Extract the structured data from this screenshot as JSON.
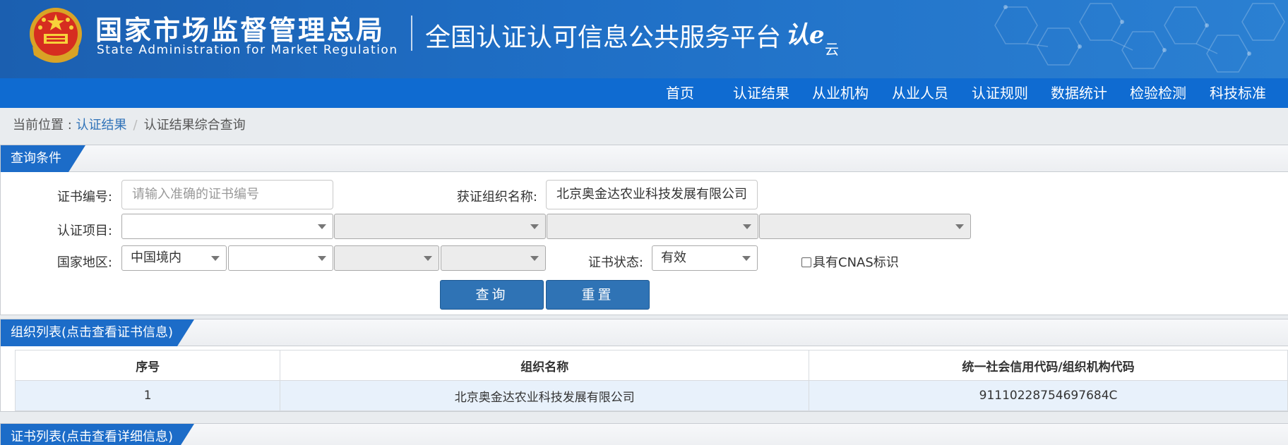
{
  "header": {
    "agency_cn": "国家市场监督管理总局",
    "agency_en": "State Administration  for  Market Regulation",
    "platform_title": "全国认证认可信息公共服务平台",
    "logo_main": "认e",
    "logo_small": "云",
    "brand_color": "#1b5fb0"
  },
  "nav": {
    "items": [
      "首页",
      "认证结果",
      "从业机构",
      "从业人员",
      "认证规则",
      "数据统计",
      "检验检测",
      "科技标准"
    ]
  },
  "breadcrumb": {
    "prefix": "当前位置 : ",
    "link": "认证结果",
    "separator": "/",
    "current": "认证结果综合查询"
  },
  "query_panel": {
    "title": "查询条件",
    "cert_no_label": "证书编号:",
    "cert_no_placeholder": "请输入准确的证书编号",
    "org_name_label": "获证组织名称:",
    "org_name_value": "北京奥金达农业科技发展有限公司",
    "project_label": "认证项目:",
    "region_label": "国家地区:",
    "region_value": "中国境内",
    "status_label": "证书状态:",
    "status_value": "有效",
    "cnas_label": "具有CNAS标识",
    "search_button": "查询",
    "reset_button": "重置"
  },
  "org_panel": {
    "title": "组织列表(点击查看证书信息)",
    "columns": [
      "序号",
      "组织名称",
      "统一社会信用代码/组织机构代码"
    ],
    "rows": [
      [
        "1",
        "北京奥金达农业科技发展有限公司",
        "91110228754697684C"
      ]
    ]
  },
  "cert_panel": {
    "title": "证书列表(点击查看详细信息)"
  }
}
